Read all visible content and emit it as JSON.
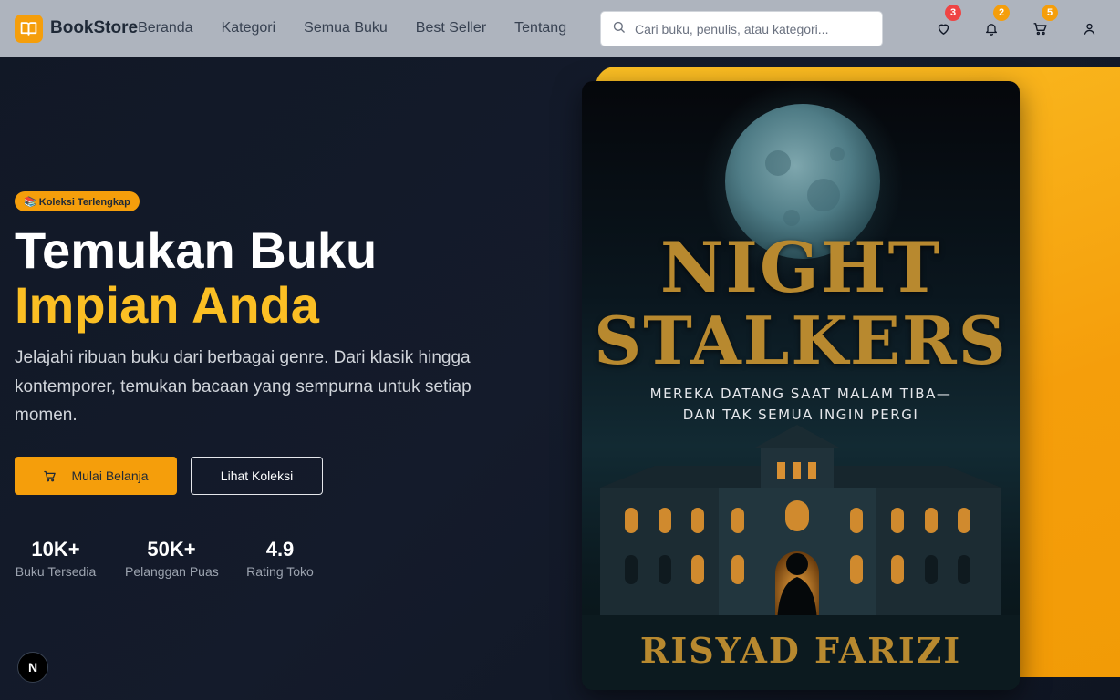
{
  "nav": {
    "brand": "BookStore",
    "links": [
      "Beranda",
      "Kategori",
      "Semua Buku",
      "Best Seller",
      "Tentang"
    ],
    "search_placeholder": "Cari buku, penulis, atau kategori...",
    "wishlist_count": "3",
    "notification_count": "2",
    "cart_count": "5"
  },
  "hero": {
    "badge": "📚 Koleksi Terlengkap",
    "title_line1": "Temukan Buku",
    "title_line2": "Impian Anda",
    "description": "Jelajahi ribuan buku dari berbagai genre. Dari klasik hingga kontemporer, temukan bacaan yang sempurna untuk setiap momen.",
    "primary_button": "Mulai Belanja",
    "secondary_button": "Lihat Koleksi",
    "stats": [
      {
        "value": "10K+",
        "label": "Buku Tersedia"
      },
      {
        "value": "50K+",
        "label": "Pelanggan Puas"
      },
      {
        "value": "4.9",
        "label": "Rating Toko"
      }
    ]
  },
  "book": {
    "title_line1": "NIGHT",
    "title_line2": "STALKERS",
    "tagline_line1": "MEREKA DATANG SAAT MALAM TIBA—",
    "tagline_line2": "DAN TAK SEMUA INGIN PERGI",
    "author": "RISYAD FARIZI"
  },
  "dev_badge": "N",
  "colors": {
    "accent": "#f59e0b",
    "accent_light": "#fbbf24",
    "nav_bg": "#aeb4be",
    "hero_bg": "#141b2b",
    "badge_red": "#ef4444"
  }
}
